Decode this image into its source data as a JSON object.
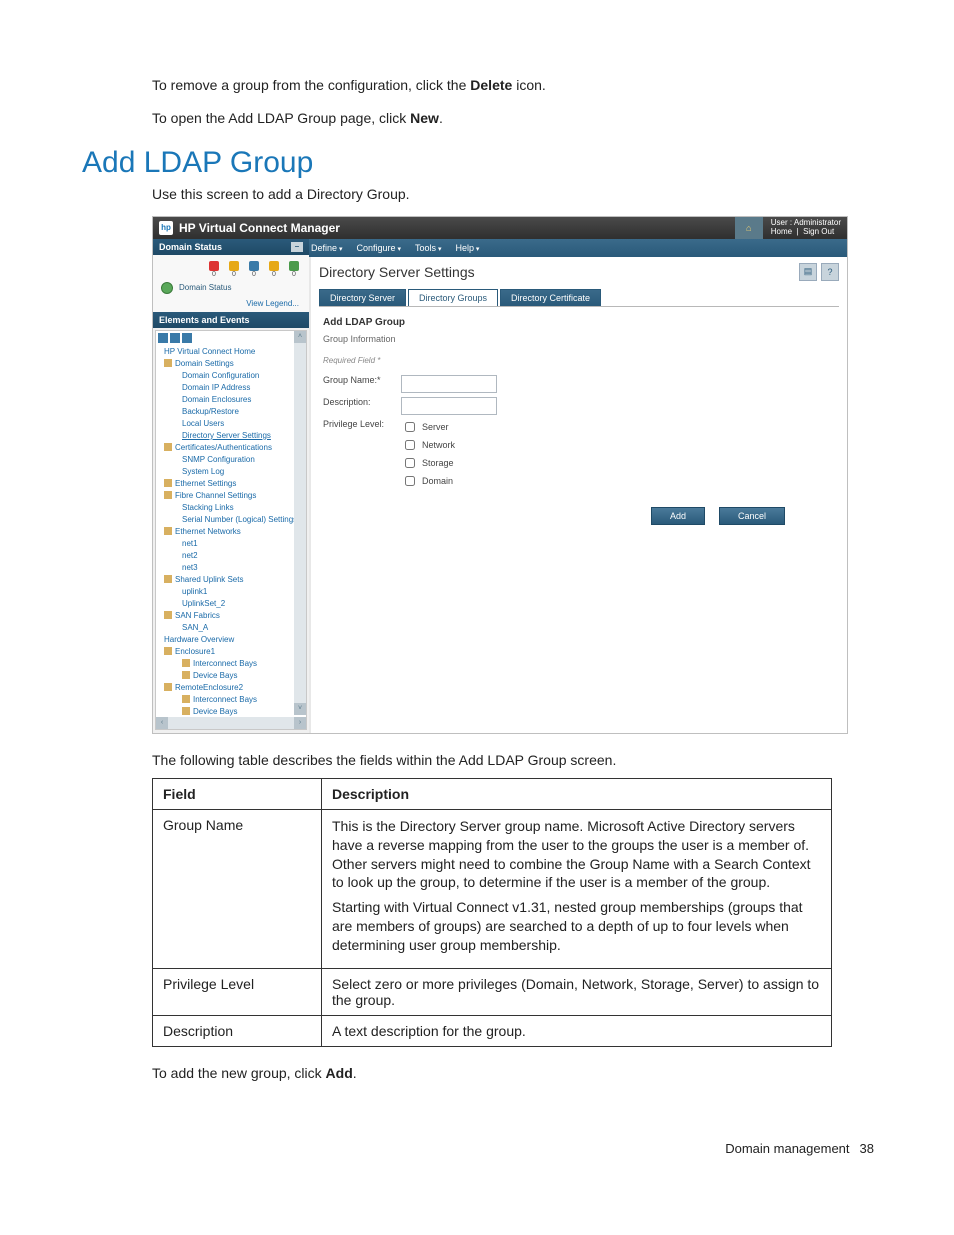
{
  "intro": {
    "line1_a": "To remove a group from the configuration, click the ",
    "line1_bold": "Delete",
    "line1_b": " icon.",
    "line2_a": "To open the Add LDAP Group page, click ",
    "line2_bold": "New",
    "line2_b": "."
  },
  "section_title": "Add LDAP Group",
  "lead": "Use this screen to add a Directory Group.",
  "shot": {
    "app_title": "HP Virtual Connect Manager",
    "user_label": "User : Administrator",
    "home_link": "Home",
    "signout_link": "Sign Out",
    "menus": [
      "Define",
      "Configure",
      "Tools",
      "Help"
    ],
    "panel_domain_status": "Domain Status",
    "status_counts": [
      "0",
      "0",
      "0",
      "0",
      "0"
    ],
    "domain_status_label": "Domain Status",
    "view_legend": "View Legend...",
    "panel_elements": "Elements and Events",
    "tree": {
      "items": [
        {
          "label": "HP Virtual Connect Home"
        },
        {
          "label": "Domain Settings",
          "folder": true
        },
        {
          "label": "Domain Configuration",
          "indent": 1
        },
        {
          "label": "Domain IP Address",
          "indent": 1
        },
        {
          "label": "Domain Enclosures",
          "indent": 1
        },
        {
          "label": "Backup/Restore",
          "indent": 1
        },
        {
          "label": "Local Users",
          "indent": 1
        },
        {
          "label": "Directory Server Settings",
          "indent": 1,
          "hl": true
        },
        {
          "label": "Certificates/Authentications",
          "folder": true
        },
        {
          "label": "SNMP Configuration",
          "indent": 1
        },
        {
          "label": "System Log",
          "indent": 1
        },
        {
          "label": "Ethernet Settings",
          "folder": true
        },
        {
          "label": "Fibre Channel Settings",
          "folder": true
        },
        {
          "label": "Stacking Links",
          "indent": 1
        },
        {
          "label": "Serial Number (Logical) Settings",
          "indent": 1
        },
        {
          "label": "Ethernet Networks",
          "folder": true
        },
        {
          "label": "net1",
          "indent": 1
        },
        {
          "label": "net2",
          "indent": 1
        },
        {
          "label": "net3",
          "indent": 1
        },
        {
          "label": "Shared Uplink Sets",
          "folder": true
        },
        {
          "label": "uplink1",
          "indent": 1
        },
        {
          "label": "UplinkSet_2",
          "indent": 1
        },
        {
          "label": "SAN Fabrics",
          "folder": true
        },
        {
          "label": "SAN_A",
          "indent": 1
        },
        {
          "label": "Hardware Overview"
        },
        {
          "label": "Enclosure1",
          "folder": true
        },
        {
          "label": "Interconnect Bays",
          "folder": true,
          "indent": 1
        },
        {
          "label": "Device Bays",
          "folder": true,
          "indent": 1
        },
        {
          "label": "RemoteEnclosure2",
          "folder": true
        },
        {
          "label": "Interconnect Bays",
          "folder": true,
          "indent": 1
        },
        {
          "label": "Device Bays",
          "folder": true,
          "indent": 1
        }
      ]
    },
    "page_title": "Directory Server Settings",
    "tabs": [
      "Directory Server",
      "Directory Groups",
      "Directory Certificate"
    ],
    "form": {
      "heading": "Add LDAP Group",
      "sub": "Group Information",
      "required": "Required Field *",
      "group_name": "Group Name:*",
      "description": "Description:",
      "privilege": "Privilege Level:",
      "priv_opts": [
        "Server",
        "Network",
        "Storage",
        "Domain"
      ],
      "add": "Add",
      "cancel": "Cancel"
    }
  },
  "desc_intro": "The following table describes the fields within the Add LDAP Group screen.",
  "table": {
    "h1": "Field",
    "h2": "Description",
    "rows": [
      {
        "f": "Group Name",
        "d1": "This is the Directory Server group name. Microsoft Active Directory servers have a reverse mapping from the user to the groups the user is a member of. Other servers might need to combine the Group Name with a Search Context to look up the group, to determine if the user is a member of the group.",
        "d2": "Starting with Virtual Connect v1.31, nested group memberships (groups that are members of groups) are searched to a depth of up to four levels when determining user group membership."
      },
      {
        "f": "Privilege Level",
        "d1": "Select zero or more privileges (Domain, Network, Storage, Server) to assign to the group."
      },
      {
        "f": "Description",
        "d1": "A text description for the group."
      }
    ]
  },
  "closing_a": "To add the new group, click ",
  "closing_bold": "Add",
  "closing_b": ".",
  "footer_section": "Domain management",
  "footer_page": "38"
}
